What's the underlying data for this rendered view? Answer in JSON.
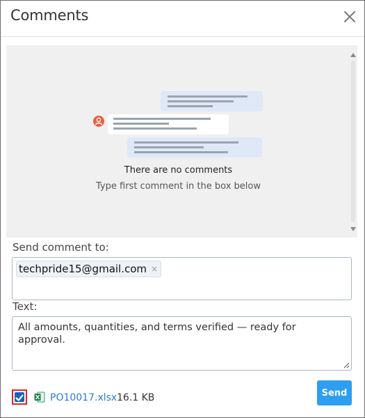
{
  "header": {
    "title": "Comments",
    "close_icon": "close-icon"
  },
  "comments": {
    "empty_title": "There are no comments",
    "empty_subtitle": "Type first comment in the box below",
    "illustration_icon": "chat-bubbles-illustration",
    "avatar_color": "#e8613a"
  },
  "send_to": {
    "label": "Send comment to:",
    "recipients": [
      "techpride15@gmail.com"
    ],
    "remove_symbol": "×"
  },
  "text": {
    "label": "Text:",
    "value": "All amounts, quantities, and terms verified — ready for approval."
  },
  "attachment": {
    "checked": true,
    "file_icon": "excel-icon",
    "file_name": "PO10017.xlsx",
    "file_size": "16.1 KB"
  },
  "actions": {
    "send_label": "Send"
  },
  "colors": {
    "accent": "#2e9ef1",
    "link": "#2a7bd4",
    "checkbox_highlight": "#e02424",
    "checkbox_fill": "#1565c0"
  }
}
